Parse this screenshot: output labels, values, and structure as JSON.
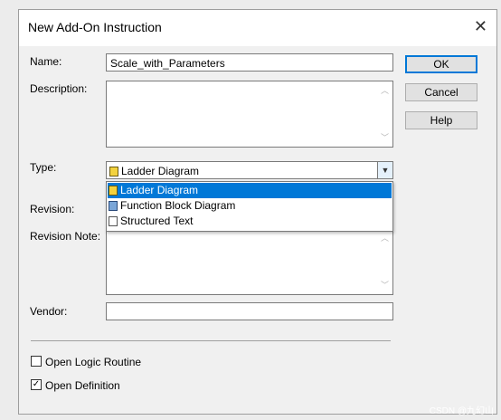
{
  "window": {
    "title": "New Add-On Instruction",
    "close_glyph": "✕"
  },
  "form": {
    "name_label": "Name:",
    "name_value": "Scale_with_Parameters",
    "description_label": "Description:",
    "description_value": "",
    "type_label": "Type:",
    "type_selected": "Ladder Diagram",
    "type_options": [
      {
        "label": "Ladder Diagram",
        "icon": "ladder-diagram-icon"
      },
      {
        "label": "Function Block Diagram",
        "icon": "function-block-diagram-icon"
      },
      {
        "label": "Structured Text",
        "icon": "structured-text-icon"
      }
    ],
    "revision_label": "Revision:",
    "revision_note_label": "Revision Note:",
    "revision_note_value": "",
    "vendor_label": "Vendor:",
    "vendor_value": ""
  },
  "buttons": {
    "ok": "OK",
    "cancel": "Cancel",
    "help": "Help"
  },
  "options": {
    "open_logic_routine": {
      "label": "Open Logic Routine",
      "checked": false
    },
    "open_definition": {
      "label": "Open Definition",
      "checked": true
    }
  },
  "watermark": "CSDN @九幻山",
  "colors": {
    "selection": "#0078d7",
    "default_button_border": "#0078d7"
  }
}
